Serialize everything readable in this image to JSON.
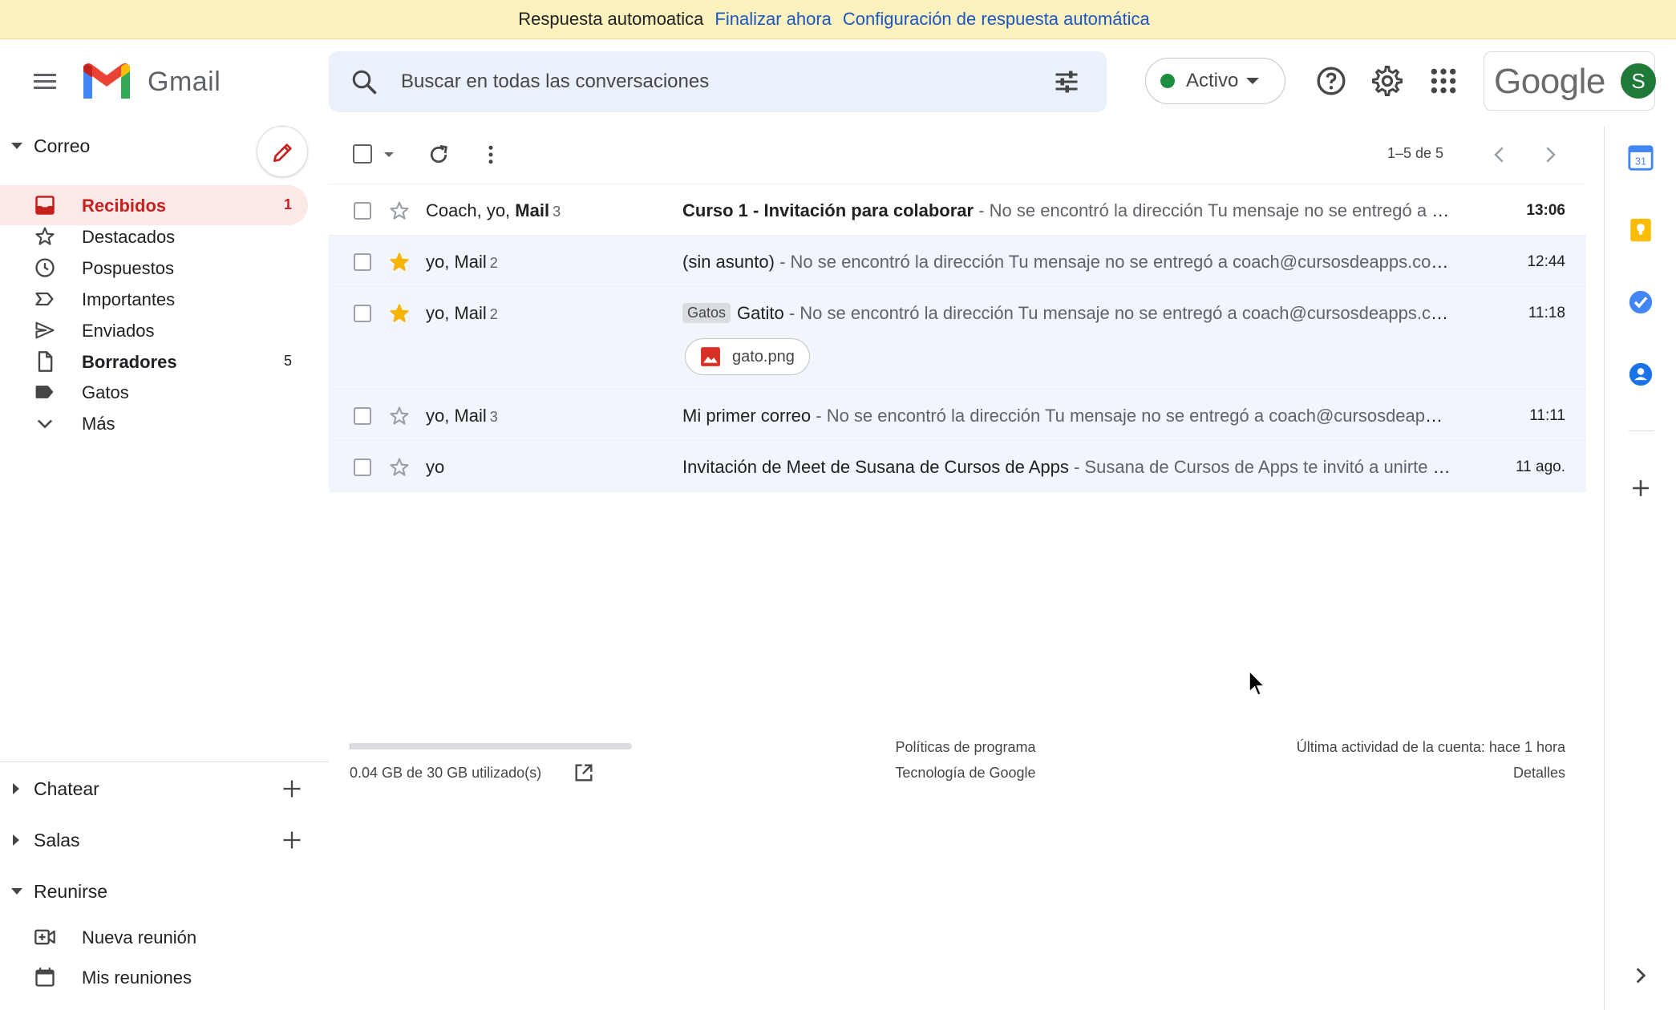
{
  "banner": {
    "message": "Respuesta automoatica",
    "end_link": "Finalizar ahora",
    "config_link": "Configuración de respuesta automática"
  },
  "header": {
    "app_name": "Gmail",
    "search_placeholder": "Buscar en todas las conversaciones",
    "status_label": "Activo",
    "account_brand": "Google",
    "avatar_initial": "S"
  },
  "sidebar": {
    "mail_section": "Correo",
    "items": [
      {
        "label": "Recibidos",
        "count": "1",
        "icon": "inbox-icon"
      },
      {
        "label": "Destacados",
        "count": "",
        "icon": "star-icon"
      },
      {
        "label": "Pospuestos",
        "count": "",
        "icon": "clock-icon"
      },
      {
        "label": "Importantes",
        "count": "",
        "icon": "important-icon"
      },
      {
        "label": "Enviados",
        "count": "",
        "icon": "send-icon"
      },
      {
        "label": "Borradores",
        "count": "5",
        "icon": "draft-icon"
      },
      {
        "label": "Gatos",
        "count": "",
        "icon": "label-icon"
      },
      {
        "label": "Más",
        "count": "",
        "icon": "chevron-down-icon"
      }
    ],
    "chat_section": "Chatear",
    "rooms_section": "Salas",
    "meet_section": "Reunirse",
    "meet_items": [
      {
        "label": "Nueva reunión",
        "icon": "video-plus-icon"
      },
      {
        "label": "Mis reuniones",
        "icon": "calendar-icon"
      }
    ]
  },
  "toolbar": {
    "pagination": "1–5 de 5"
  },
  "emails": [
    {
      "sender_plain": "Coach, yo, ",
      "sender_bold": "Mail",
      "count": "3",
      "subject": "Curso 1 - Invitación para colaborar",
      "snippet": " - No se encontró la dirección Tu mensaje no se entregó a coach@cursosdeapps.com porque no se encontró la dirección o esta no puede recibir correo electrónico.",
      "time": "13:06",
      "starred": false,
      "unread": true,
      "label": "",
      "attachment": ""
    },
    {
      "sender_plain": "yo, Mail",
      "sender_bold": "",
      "count": "2",
      "subject": "(sin asunto)",
      "snippet": " - No se encontró la dirección Tu mensaje no se entregó a coach@cursosdeapps.com porque no se encontró la dirección.",
      "time": "12:44",
      "starred": true,
      "unread": false,
      "label": "",
      "attachment": ""
    },
    {
      "sender_plain": "yo, Mail",
      "sender_bold": "",
      "count": "2",
      "subject": "Gatito",
      "snippet": " - No se encontró la dirección Tu mensaje no se entregó a coach@cursosdeapps.com porque no se encontró la dirección.",
      "time": "11:18",
      "starred": true,
      "unread": false,
      "label": "Gatos",
      "attachment": "gato.png"
    },
    {
      "sender_plain": "yo, Mail",
      "sender_bold": "",
      "count": "3",
      "subject": "Mi primer correo",
      "snippet": " - No se encontró la dirección Tu mensaje no se entregó a coach@cursosdeapps.com porque no se encontró la dirección.",
      "time": "11:11",
      "starred": false,
      "unread": false,
      "label": "",
      "attachment": ""
    },
    {
      "sender_plain": "yo",
      "sender_bold": "",
      "count": "",
      "subject": "Invitación de Meet de Susana de Cursos de Apps",
      "snippet": " - Susana de Cursos de Apps te invitó a unirte a una reunión de Google Meet que se está llevando a cabo ahora.",
      "time": "11 ago.",
      "starred": false,
      "unread": false,
      "label": "",
      "attachment": ""
    }
  ],
  "footer": {
    "storage": "0.04 GB de 30 GB utilizado(s)",
    "storage_fraction": 0.0013,
    "policies": "Políticas de programa",
    "tech": "Tecnología de Google",
    "last_activity": "Última actividad de la cuenta: hace 1 hora",
    "details": "Detalles"
  },
  "colors": {
    "accent_red": "#c5221f",
    "banner_bg": "#fdf2bd",
    "link_blue": "#1a56c4",
    "star_yellow": "#f4b400",
    "status_green": "#1e8e3e"
  }
}
